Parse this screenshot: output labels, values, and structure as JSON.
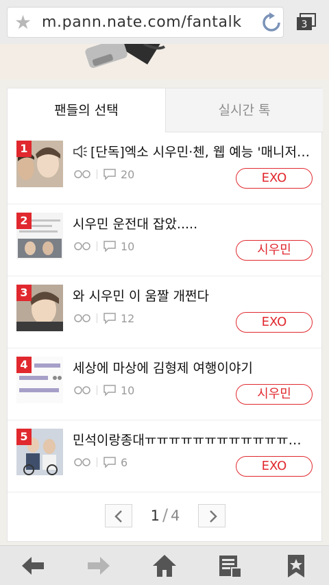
{
  "browser": {
    "url": "m.pann.nate.com/fantalk",
    "tab_count": "3"
  },
  "tabs": [
    {
      "label": "팬들의 선택",
      "active": true
    },
    {
      "label": "실시간 톡",
      "active": false
    }
  ],
  "posts": [
    {
      "rank": "1",
      "title": "[단독]엑소 시우민·첸, 웹 예능 '매니저 ...",
      "has_speaker_icon": true,
      "views_icon": "view-icon",
      "comments": "20",
      "tag": "EXO"
    },
    {
      "rank": "2",
      "title": "시우민 운전대 잡았.....",
      "has_speaker_icon": false,
      "views_icon": "view-icon",
      "comments": "10",
      "tag": "시우민"
    },
    {
      "rank": "3",
      "title": "와 시우민 이 움짤 개쩐다",
      "has_speaker_icon": false,
      "views_icon": "view-icon",
      "comments": "12",
      "tag": "EXO"
    },
    {
      "rank": "4",
      "title": "세상에 마상에 김형제 여행이야기",
      "has_speaker_icon": false,
      "views_icon": "view-icon",
      "comments": "10",
      "tag": "시우민"
    },
    {
      "rank": "5",
      "title": "민석이랑종대ㅠㅠㅠㅠㅠㅠㅠㅠㅠㅠㅠㅠㅠㅠㅠ",
      "has_speaker_icon": false,
      "views_icon": "view-icon",
      "comments": "6",
      "tag": "EXO"
    }
  ],
  "pager": {
    "current": "1",
    "separator": "/",
    "total": "4"
  },
  "bottom_nav": [
    {
      "icon": "back-arrow-icon"
    },
    {
      "icon": "forward-arrow-icon"
    },
    {
      "icon": "home-icon"
    },
    {
      "icon": "reader-icon"
    },
    {
      "icon": "bookmark-icon"
    }
  ],
  "colors": {
    "accent": "#e0282e",
    "muted": "#9a9a9a",
    "icon_dark": "#555555",
    "icon_disabled": "#b5b5b5"
  }
}
